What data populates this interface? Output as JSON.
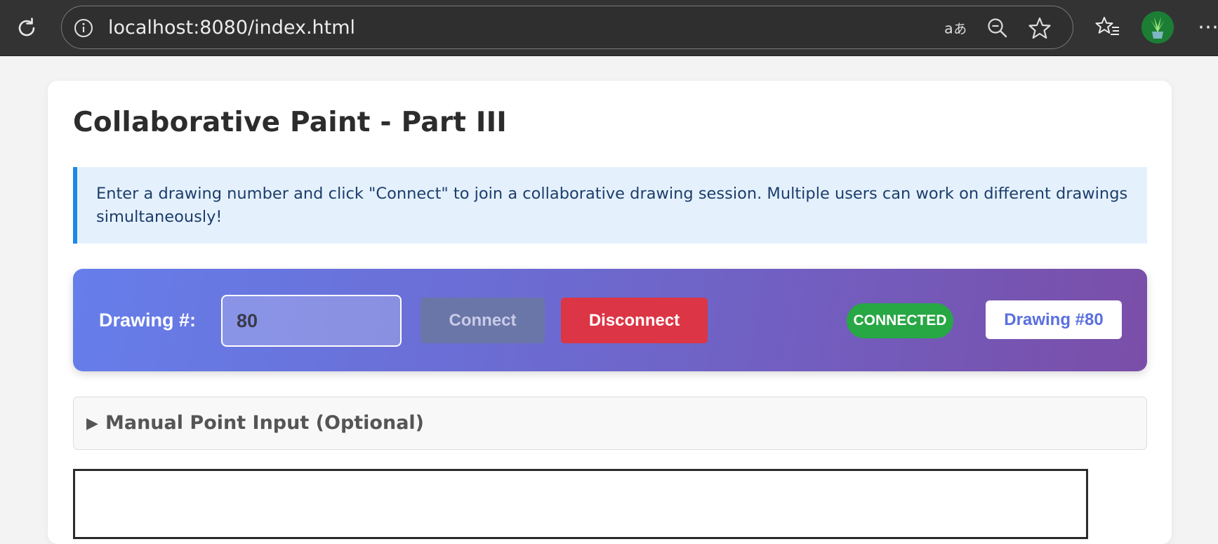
{
  "browser": {
    "url": "localhost:8080/index.html",
    "more_label": "⋯"
  },
  "page": {
    "title": "Collaborative Paint - Part III",
    "info_text": "Enter a drawing number and click \"Connect\" to join a collaborative drawing session. Multiple users can work on different drawings simultaneously!"
  },
  "controls": {
    "drawing_label": "Drawing #:",
    "drawing_value": "80",
    "connect_label": "Connect",
    "disconnect_label": "Disconnect",
    "status": "CONNECTED",
    "current_drawing": "Drawing #80"
  },
  "manual_input": {
    "arrow": "▶",
    "title": "Manual Point Input (Optional)"
  },
  "colors": {
    "status_connected": "#28a745",
    "disconnect": "#dc3545",
    "panel_gradient_start": "#667eea",
    "panel_gradient_end": "#7a4ea8",
    "info_accent": "#1e88e5"
  },
  "icons": [
    "reload-icon",
    "info-icon",
    "read-aloud-icon",
    "zoom-out-icon",
    "favorite-star-icon",
    "favorites-list-icon",
    "profile-avatar-icon",
    "more-icon"
  ]
}
